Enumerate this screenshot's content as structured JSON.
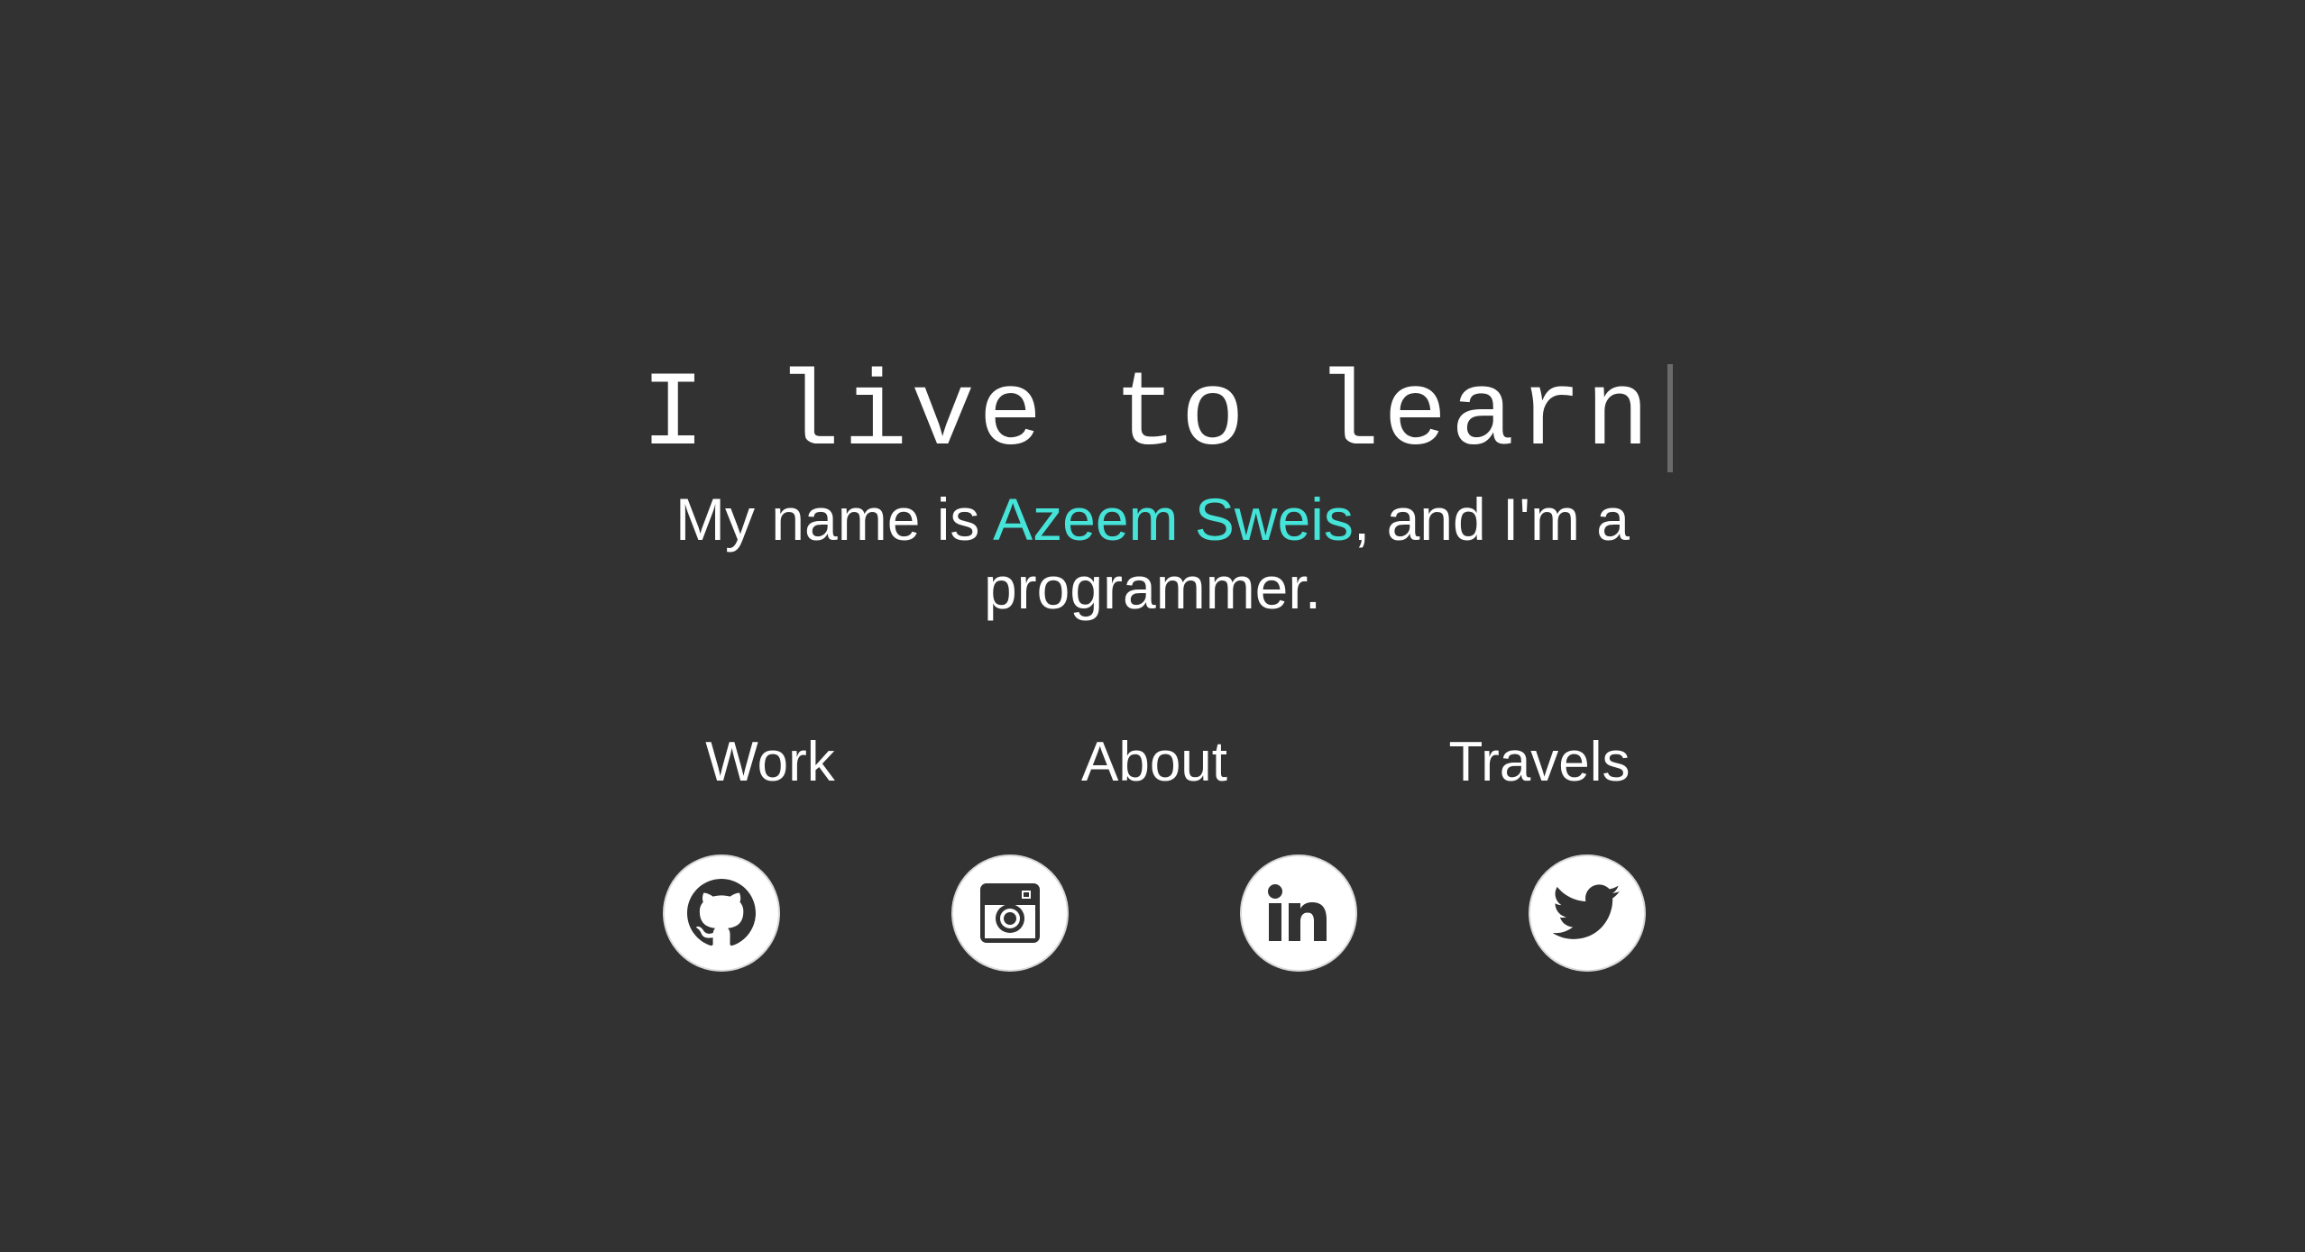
{
  "hero": {
    "headline": "I live to learn",
    "intro_before": "My name is ",
    "intro_name": "Azeem Sweis",
    "intro_after": ", and I'm a programmer."
  },
  "nav": {
    "items": [
      {
        "label": "Work"
      },
      {
        "label": "About"
      },
      {
        "label": "Travels"
      }
    ]
  },
  "social": {
    "items": [
      {
        "icon": "github-icon"
      },
      {
        "icon": "instagram-icon"
      },
      {
        "icon": "linkedin-icon"
      },
      {
        "icon": "twitter-icon"
      }
    ]
  },
  "colors": {
    "background": "#323232",
    "text": "#ffffff",
    "accent": "#45e3d8",
    "cursor": "#6a6a6a",
    "icon": "#323232"
  }
}
